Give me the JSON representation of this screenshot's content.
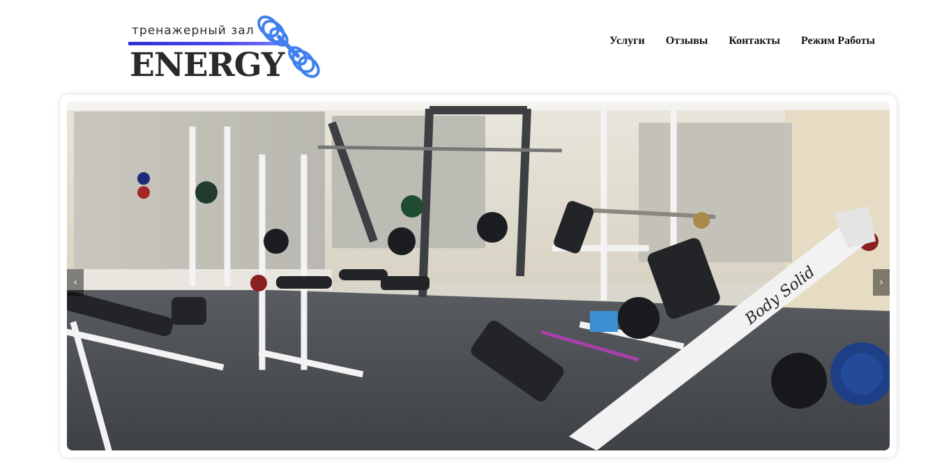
{
  "logo": {
    "subtitle": "тренажерный зал",
    "name": "ENERGY",
    "accent_color": "#3f7ff0",
    "line_color": "#3a3ae6"
  },
  "nav": {
    "items": [
      {
        "label": "Услуги"
      },
      {
        "label": "Отзывы"
      },
      {
        "label": "Контакты"
      },
      {
        "label": "Режим Работы"
      }
    ]
  },
  "slider": {
    "prev_label": "‹",
    "next_label": "›",
    "machine_brand": "Body Solid",
    "image_subject": "gym-interior-photo"
  }
}
